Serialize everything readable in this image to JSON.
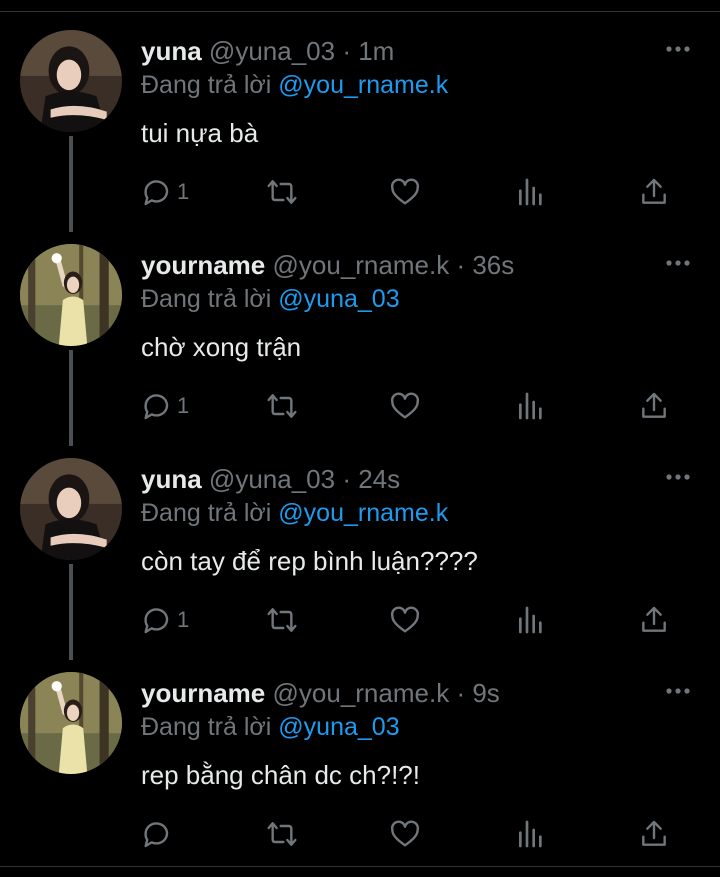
{
  "colors": {
    "background": "#000000",
    "text": "#e7e9ea",
    "muted": "#71767b",
    "accent": "#1d9bf0",
    "thread_line": "#4b4f53"
  },
  "reply_to_prefix": "Đang trả lời",
  "tweets": [
    {
      "name": "yuna",
      "handle": "@yuna_03",
      "separator": "·",
      "time": "1m",
      "reply_to": "@you_rname.k",
      "text": "tui nựa bà",
      "reply_count": "1",
      "avatar": "yuna-avatar"
    },
    {
      "name": "yourname",
      "handle": "@you_rname.k",
      "separator": "·",
      "time": "36s",
      "reply_to": "@yuna_03",
      "text": "chờ xong trận",
      "reply_count": "1",
      "avatar": "yourname-avatar"
    },
    {
      "name": "yuna",
      "handle": "@yuna_03",
      "separator": "·",
      "time": "24s",
      "reply_to": "@you_rname.k",
      "text": "còn tay để rep bình luận????",
      "reply_count": "1",
      "avatar": "yuna-avatar"
    },
    {
      "name": "yourname",
      "handle": "@you_rname.k",
      "separator": "·",
      "time": "9s",
      "reply_to": "@yuna_03",
      "text": "rep bằng chân dc ch?!?!",
      "reply_count": "",
      "avatar": "yourname-avatar"
    }
  ],
  "icons": [
    "reply-icon",
    "retweet-icon",
    "like-icon",
    "views-icon",
    "share-icon",
    "more-icon"
  ]
}
